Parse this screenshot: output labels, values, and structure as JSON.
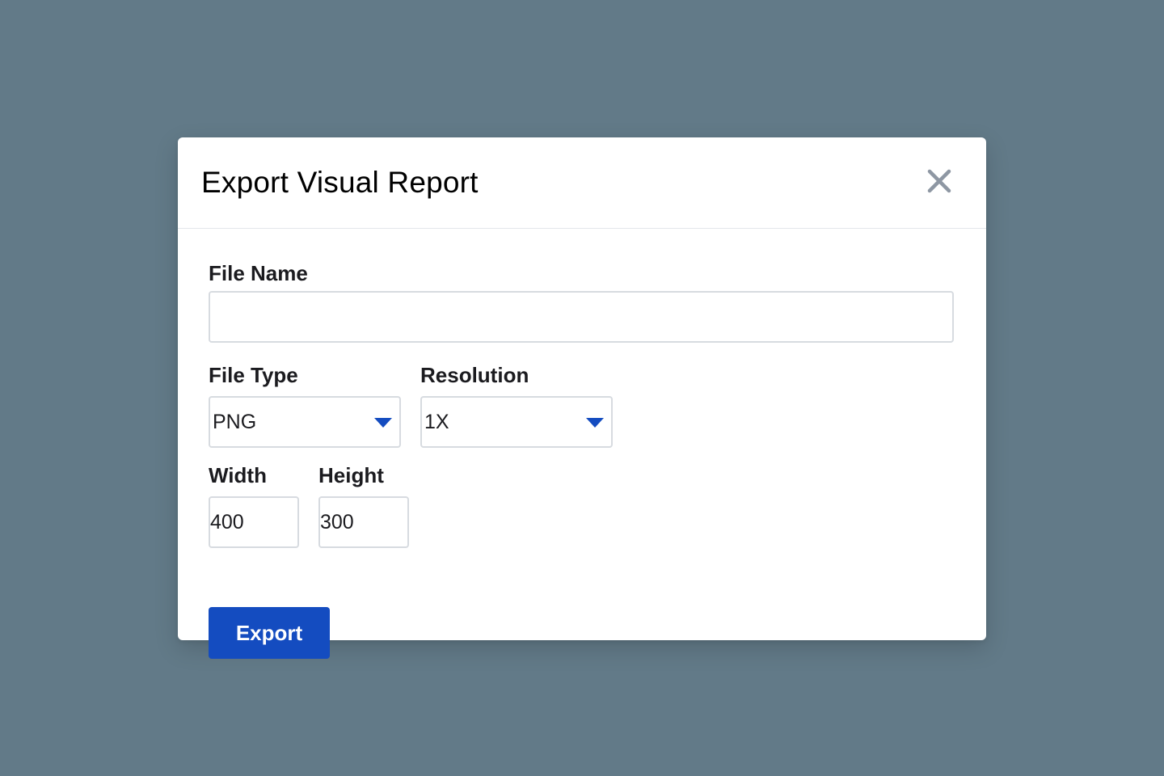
{
  "modal": {
    "title": "Export Visual Report",
    "close_icon": "close-icon"
  },
  "form": {
    "file_name": {
      "label": "File Name",
      "value": "",
      "placeholder": ""
    },
    "file_type": {
      "label": "File Type",
      "selected": "PNG",
      "icon": "chevron-down-icon"
    },
    "resolution": {
      "label": "Resolution",
      "selected": "1X",
      "icon": "chevron-down-icon"
    },
    "width": {
      "label": "Width",
      "value": "400"
    },
    "height": {
      "label": "Height",
      "value": "300"
    },
    "export_label": "Export"
  },
  "colors": {
    "backdrop": "#627a88",
    "primary": "#144cc0",
    "close_icon": "#8e97a3",
    "input_border": "#d7dbe0"
  }
}
